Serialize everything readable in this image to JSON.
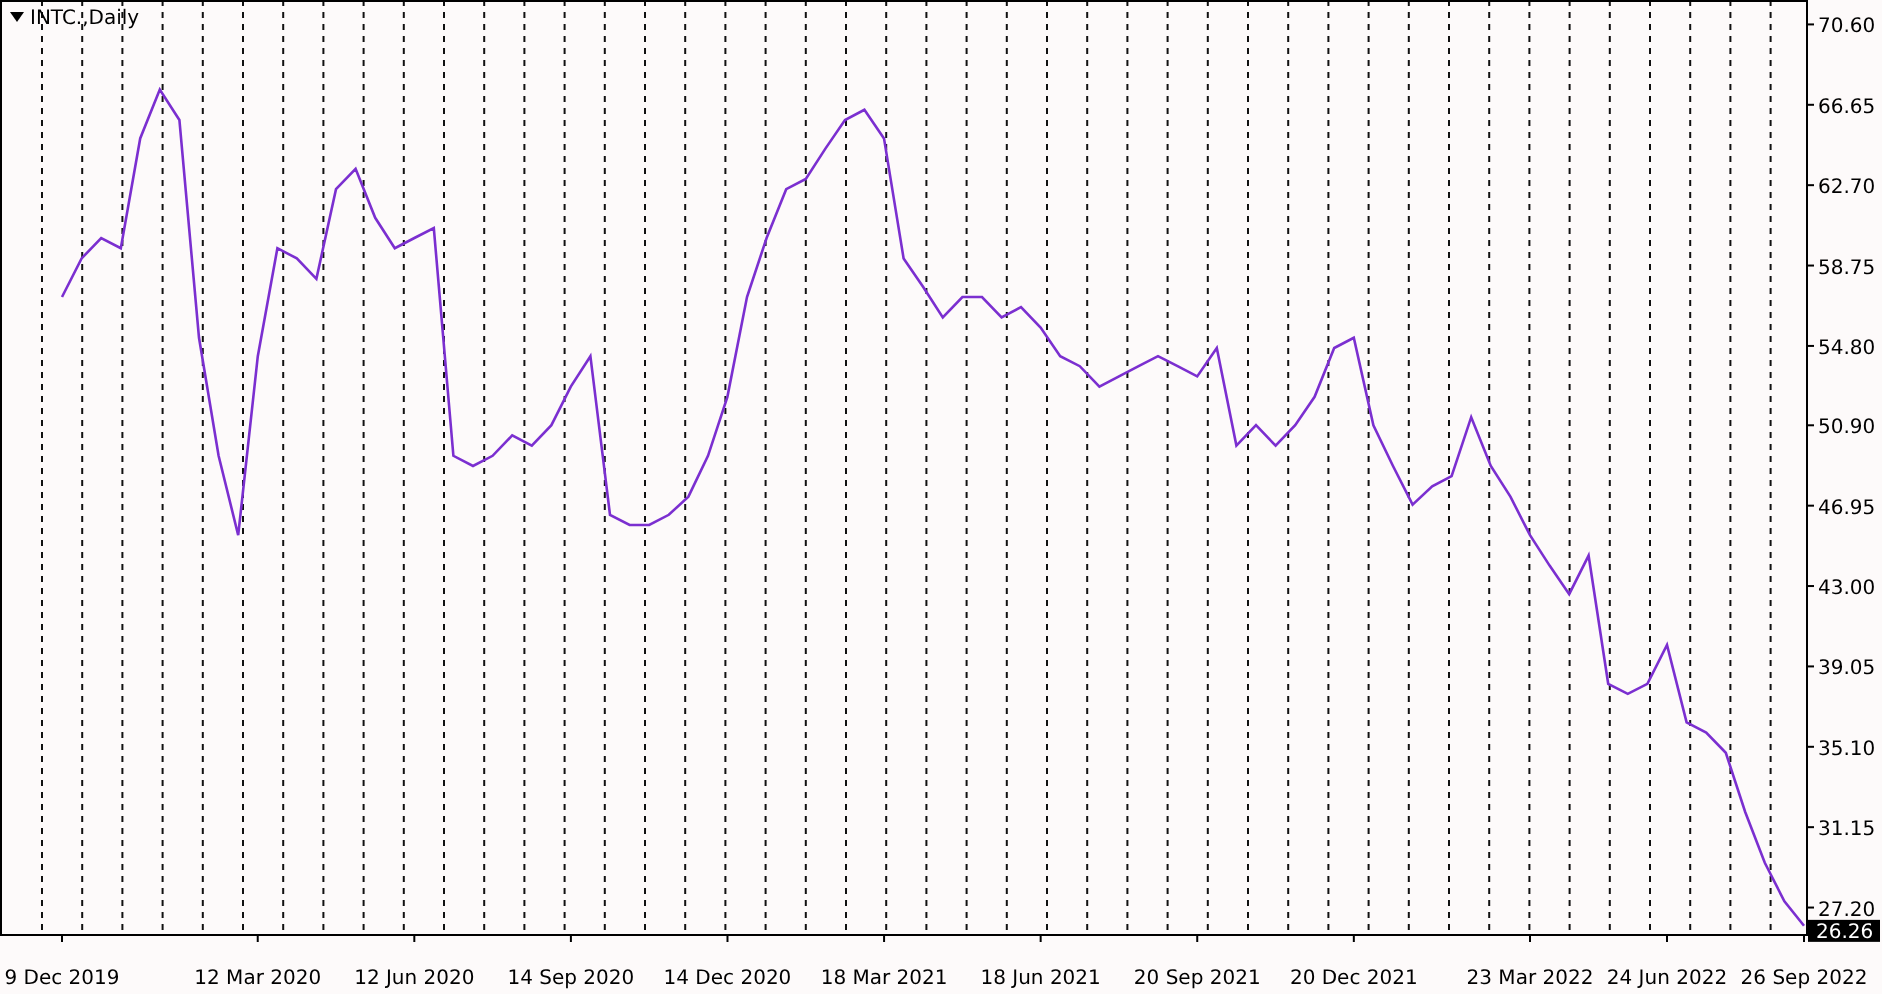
{
  "title": "INTC.,Daily",
  "chart": {
    "last_price": "26.26",
    "chart_data": {
      "type": "line",
      "grid": true,
      "ylim": [
        25.9,
        71.8
      ],
      "categories": [
        "9 Dec 2019",
        null,
        null,
        null,
        null,
        null,
        null,
        null,
        null,
        null,
        "12 Mar 2020",
        null,
        null,
        null,
        null,
        null,
        null,
        null,
        "12 Jun 2020",
        null,
        null,
        null,
        null,
        null,
        null,
        null,
        "14 Sep 2020",
        null,
        null,
        null,
        null,
        null,
        null,
        null,
        "14 Dec 2020",
        null,
        null,
        null,
        null,
        null,
        null,
        null,
        "18 Mar 2021",
        null,
        null,
        null,
        null,
        null,
        null,
        null,
        "18 Jun 2021",
        null,
        null,
        null,
        null,
        null,
        null,
        null,
        "20 Sep 2021",
        null,
        null,
        null,
        null,
        null,
        null,
        null,
        "20 Dec 2021",
        null,
        null,
        null,
        null,
        null,
        null,
        null,
        null,
        "23 Mar 2022",
        null,
        null,
        null,
        null,
        null,
        null,
        "24 Jun 2022",
        null,
        null,
        null,
        null,
        null,
        null,
        "26 Sep 2022"
      ],
      "yticks": [
        {
          "value": 70.6,
          "label": "70.60"
        },
        {
          "value": 66.65,
          "label": "66.65"
        },
        {
          "value": 62.7,
          "label": "62.70"
        },
        {
          "value": 58.75,
          "label": "58.75"
        },
        {
          "value": 54.8,
          "label": "54.80"
        },
        {
          "value": 50.9,
          "label": "50.90"
        },
        {
          "value": 46.95,
          "label": "46.95"
        },
        {
          "value": 43.0,
          "label": "43.00"
        },
        {
          "value": 39.05,
          "label": "39.05"
        },
        {
          "value": 35.1,
          "label": "35.10"
        },
        {
          "value": 31.15,
          "label": "31.15"
        },
        {
          "value": 27.2,
          "label": "27.20"
        }
      ],
      "series": [
        {
          "color": "#7b2fd0",
          "values": [
            57.2,
            59.1,
            60.1,
            59.6,
            65.0,
            67.4,
            65.9,
            55.2,
            49.4,
            45.5,
            54.3,
            59.6,
            59.1,
            58.1,
            62.5,
            63.5,
            61.1,
            59.6,
            60.1,
            60.6,
            49.4,
            48.9,
            49.4,
            50.4,
            49.9,
            50.9,
            52.8,
            54.3,
            46.5,
            46.0,
            46.0,
            46.5,
            47.4,
            49.4,
            52.3,
            57.2,
            60.1,
            62.5,
            63.0,
            64.5,
            65.9,
            66.4,
            65.0,
            59.1,
            57.7,
            56.2,
            57.2,
            57.2,
            56.2,
            56.7,
            55.7,
            54.3,
            53.8,
            52.8,
            53.3,
            53.8,
            54.3,
            53.8,
            53.3,
            54.7,
            49.9,
            50.9,
            49.9,
            50.9,
            52.3,
            54.7,
            55.2,
            50.9,
            48.9,
            47.0,
            47.9,
            48.4,
            51.3,
            48.9,
            47.4,
            45.5,
            44.0,
            42.6,
            44.5,
            38.2,
            37.7,
            38.2,
            40.1,
            36.3,
            35.8,
            34.8,
            31.9,
            29.4,
            27.5,
            26.3
          ]
        }
      ]
    }
  }
}
